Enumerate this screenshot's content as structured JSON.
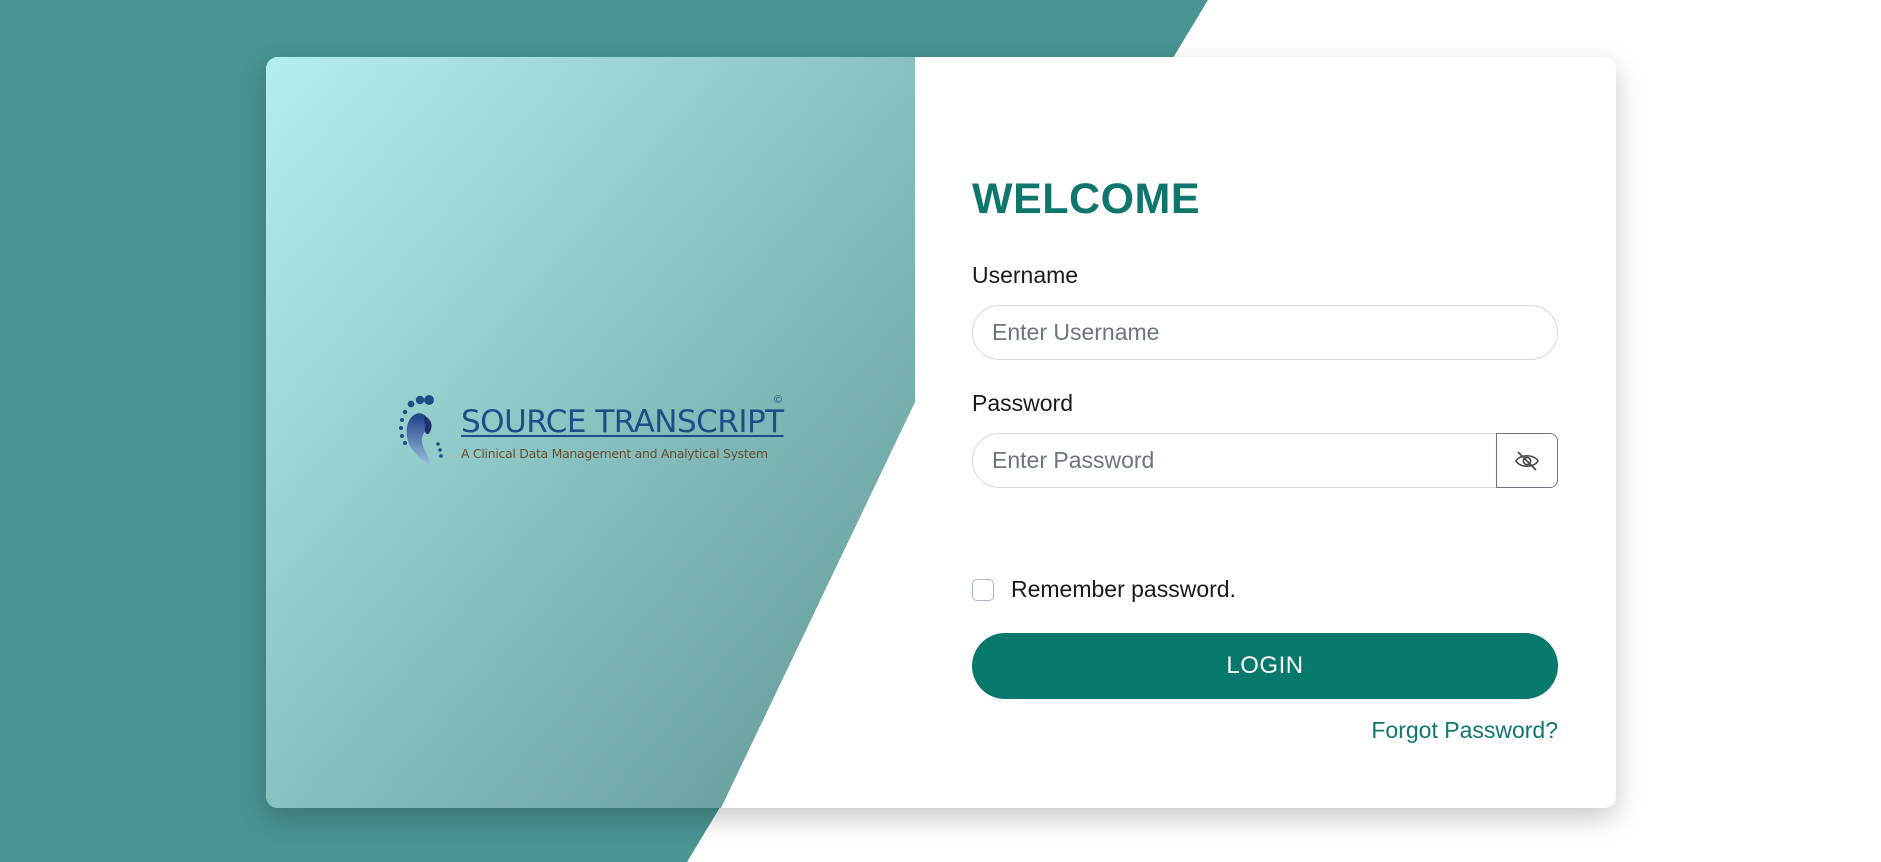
{
  "colors": {
    "page_background": "#ffffff",
    "teal_background": "#4a9494",
    "gradient_start": "#b3efed",
    "gradient_end": "#5e9694",
    "accent": "#0f766e",
    "button": "#06786c",
    "logo_blue": "#1f4e87",
    "logo_brown": "#6b4e2e"
  },
  "logo": {
    "title": "SOURCE TRANSCRIPT",
    "copyright": "©",
    "subtitle": "A Clinical Data Management and Analytical System",
    "icon": "footprint-logo-icon"
  },
  "form": {
    "heading": "WELCOME",
    "username": {
      "label": "Username",
      "placeholder": "Enter Username",
      "value": ""
    },
    "password": {
      "label": "Password",
      "placeholder": "Enter Password",
      "value": "",
      "toggle_icon": "eye-slash-icon"
    },
    "remember": {
      "label": "Remember password.",
      "checked": false
    },
    "login_label": "LOGIN",
    "forgot_label": "Forgot Password?"
  }
}
